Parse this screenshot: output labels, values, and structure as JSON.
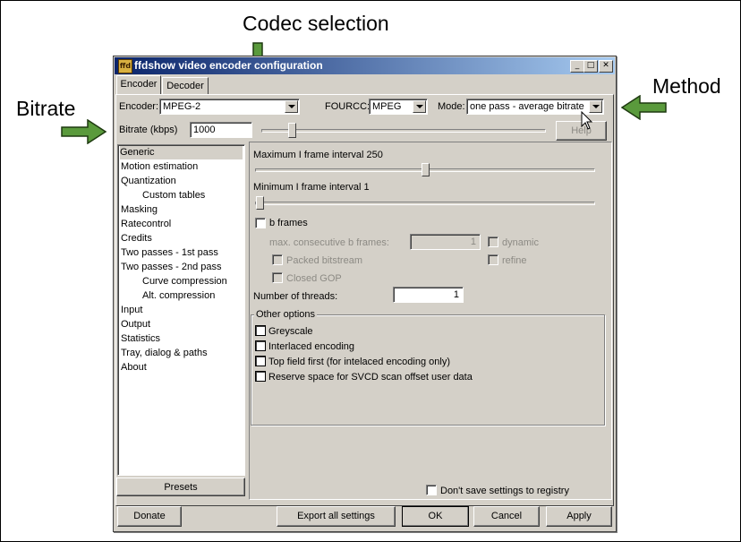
{
  "annotations": {
    "codec": "Codec selection",
    "method": "Method",
    "bitrate": "Bitrate"
  },
  "window": {
    "title": "ffdshow video encoder configuration",
    "icon": "ffdshow-app-icon",
    "title_buttons": [
      "minimize-icon",
      "maximize-icon",
      "close-icon"
    ]
  },
  "tabs": [
    {
      "label": "Encoder",
      "active": true
    },
    {
      "label": "Decoder",
      "active": false
    }
  ],
  "top": {
    "encoder_label": "Encoder:",
    "encoder_value": "MPEG-2",
    "fourcc_label": "FOURCC:",
    "fourcc_value": "MPEG",
    "mode_label": "Mode:",
    "mode_value": "one pass - average bitrate",
    "bitrate_label": "Bitrate (kbps)",
    "bitrate_value": "1000",
    "help_label": "Help"
  },
  "sidebar": {
    "items": [
      {
        "label": "Generic",
        "indent": 0,
        "selected": true
      },
      {
        "label": "Motion estimation",
        "indent": 0
      },
      {
        "label": "Quantization",
        "indent": 0
      },
      {
        "label": "Custom tables",
        "indent": 1
      },
      {
        "label": "Masking",
        "indent": 0
      },
      {
        "label": "Ratecontrol",
        "indent": 0
      },
      {
        "label": "Credits",
        "indent": 0
      },
      {
        "label": "Two passes - 1st pass",
        "indent": 0
      },
      {
        "label": "Two passes - 2nd pass",
        "indent": 0
      },
      {
        "label": "Curve compression",
        "indent": 1
      },
      {
        "label": "Alt. compression",
        "indent": 1
      },
      {
        "label": "Input",
        "indent": 0
      },
      {
        "label": "Output",
        "indent": 0
      },
      {
        "label": "Statistics",
        "indent": 0
      },
      {
        "label": "Tray, dialog & paths",
        "indent": 0
      },
      {
        "label": "About",
        "indent": 0
      }
    ],
    "presets_label": "Presets"
  },
  "generic": {
    "max_i_label": "Maximum I frame interval 250",
    "min_i_label": "Minimum I frame interval 1",
    "b_frames_label": "b frames",
    "max_consec_label": "max. consecutive b frames:",
    "max_consec_value": "1",
    "dynamic_label": "dynamic",
    "packed_label": "Packed bitstream",
    "refine_label": "refine",
    "closed_gop_label": "Closed GOP",
    "threads_label": "Number of threads:",
    "threads_value": "1",
    "other_options_title": "Other options",
    "greyscale_label": "Greyscale",
    "interlaced_label": "Interlaced encoding",
    "top_field_label": "Top field first (for intelaced encoding only)",
    "svcd_label": "Reserve space for SVCD scan offset user data"
  },
  "footer": {
    "dont_save_label": "Don't save settings to registry",
    "donate_label": "Donate",
    "export_label": "Export all settings",
    "ok_label": "OK",
    "cancel_label": "Cancel",
    "apply_label": "Apply"
  },
  "colors": {
    "dialog_bg": "#d4d0c8",
    "titlebar_start": "#0a246a",
    "titlebar_end": "#a6caf0",
    "arrow_fill": "#5a9a3c"
  }
}
